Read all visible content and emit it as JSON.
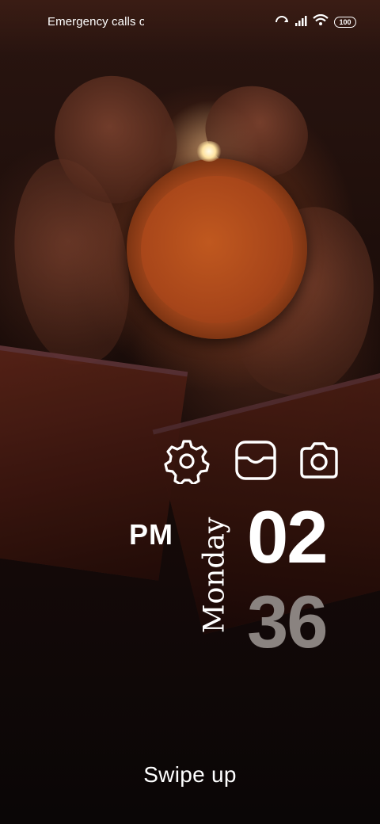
{
  "status_bar": {
    "text": "Emergency calls o",
    "battery": "100",
    "icons": [
      "sync-icon",
      "signal-icon",
      "wifi-icon",
      "battery-icon"
    ]
  },
  "shortcuts": [
    {
      "name": "settings-icon"
    },
    {
      "name": "wallet-icon"
    },
    {
      "name": "camera-icon"
    }
  ],
  "clock": {
    "ampm": "PM",
    "day": "Monday",
    "hour": "02",
    "minute": "36"
  },
  "swipe_hint": "Swipe up",
  "colors": {
    "text": "#ffffff",
    "minute": "#8a8380"
  }
}
